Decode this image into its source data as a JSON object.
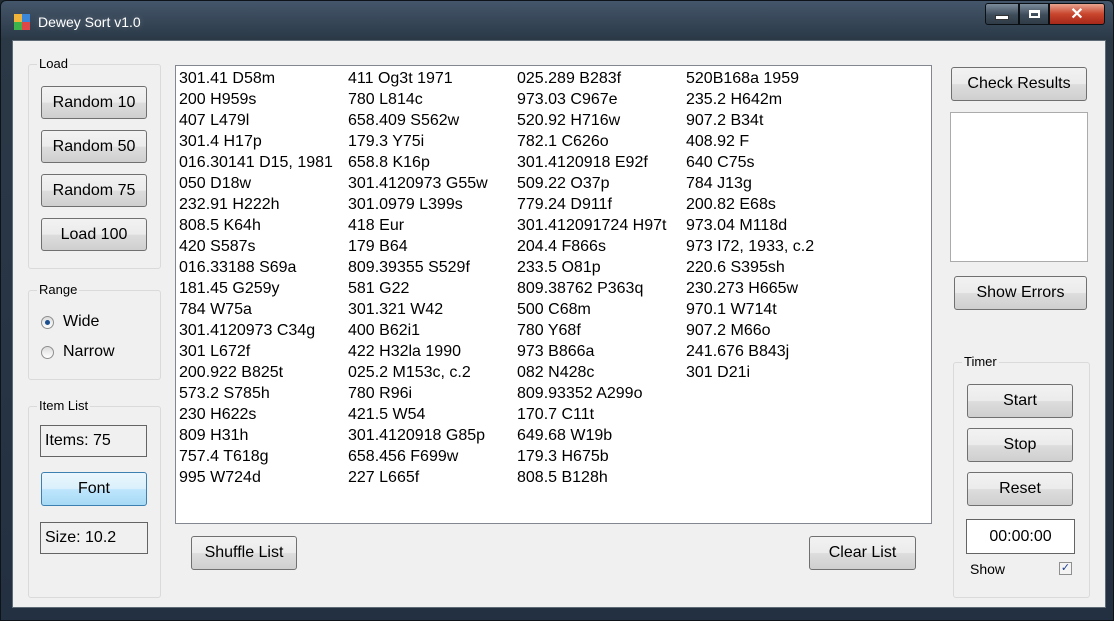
{
  "window": {
    "title": "Dewey Sort v1.0"
  },
  "load_group": {
    "title": "Load",
    "buttons": [
      "Random 10",
      "Random 50",
      "Random 75",
      "Load 100"
    ]
  },
  "range_group": {
    "title": "Range",
    "options": [
      {
        "label": "Wide",
        "checked": true
      },
      {
        "label": "Narrow",
        "checked": false
      }
    ]
  },
  "item_list_group": {
    "title": "Item List",
    "items_label": "Items: 75",
    "font_button": "Font",
    "size_label": "Size: 10.2"
  },
  "list": {
    "columns": [
      [
        "301.41 D58m",
        "200 H959s",
        "407 L479l",
        "301.4 H17p",
        "016.30141 D15, 1981",
        "050 D18w",
        "232.91 H222h",
        "808.5 K64h",
        "420 S587s",
        "016.33188 S69a",
        "181.45 G259y",
        "784 W75a",
        "301.4120973 C34g",
        "301 L672f",
        "200.922 B825t",
        "573.2 S785h",
        "230 H622s",
        "809 H31h",
        "757.4 T618g",
        "995 W724d"
      ],
      [
        "411 Og3t 1971",
        "780 L814c",
        "658.409 S562w",
        "179.3 Y75i",
        "658.8 K16p",
        "301.4120973 G55w",
        "301.0979 L399s",
        "418 Eur",
        "179 B64",
        "809.39355 S529f",
        "581 G22",
        "301.321 W42",
        "400 B62i1",
        "422 H32la 1990",
        "025.2 M153c, c.2",
        "780 R96i",
        "421.5 W54",
        "301.4120918 G85p",
        "658.456 F699w",
        "227 L665f"
      ],
      [
        "025.289 B283f",
        "973.03 C967e",
        "520.92 H716w",
        "782.1 C626o",
        "301.4120918 E92f",
        "509.22 O37p",
        "779.24 D911f",
        "301.412091724 H97t",
        "204.4 F866s",
        "233.5 O81p",
        "809.38762 P363q",
        "500 C68m",
        "780 Y68f",
        "973 B866a",
        "082 N428c",
        "809.93352 A299o",
        "170.7 C11t",
        "649.68 W19b",
        "179.3 H675b",
        "808.5 B128h"
      ],
      [
        "520B168a 1959",
        "235.2 H642m",
        "907.2 B34t",
        "408.92 F",
        "640 C75s",
        "784 J13g",
        "200.82 E68s",
        "973.04 M118d",
        "973 I72, 1933, c.2",
        "220.6 S395sh",
        "230.273 H665w",
        "970.1 W714t",
        "907.2 M66o",
        "241.676 B843j",
        "301 D21i"
      ]
    ],
    "shuffle_button": "Shuffle List",
    "clear_button": "Clear List"
  },
  "results": {
    "check_button": "Check Results",
    "show_errors_button": "Show Errors"
  },
  "timer_group": {
    "title": "Timer",
    "start_button": "Start",
    "stop_button": "Stop",
    "reset_button": "Reset",
    "display": "00:00:00",
    "show_label": "Show",
    "show_checked": true
  }
}
